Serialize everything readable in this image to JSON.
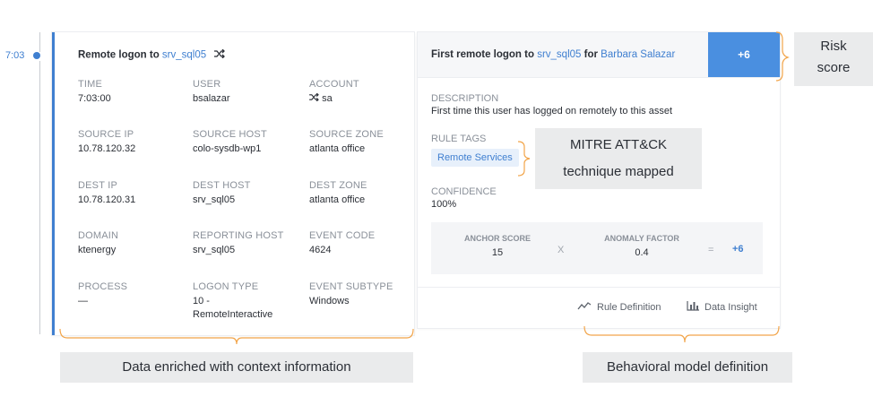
{
  "timeline": {
    "time": "7:03"
  },
  "left_card": {
    "title_prefix": "Remote logon to",
    "title_host": "srv_sql05",
    "fields": {
      "time": {
        "label": "TIME",
        "value": "7:03:00"
      },
      "user": {
        "label": "USER",
        "value": "bsalazar"
      },
      "account": {
        "label": "ACCOUNT",
        "value": "sa"
      },
      "source_ip": {
        "label": "SOURCE IP",
        "value": "10.78.120.32"
      },
      "source_host": {
        "label": "SOURCE HOST",
        "value": "colo-sysdb-wp1"
      },
      "source_zone": {
        "label": "SOURCE ZONE",
        "value": "atlanta office"
      },
      "dest_ip": {
        "label": "DEST IP",
        "value": "10.78.120.31"
      },
      "dest_host": {
        "label": "DEST HOST",
        "value": "srv_sql05"
      },
      "dest_zone": {
        "label": "DEST ZONE",
        "value": "atlanta office"
      },
      "domain": {
        "label": "DOMAIN",
        "value": "ktenergy"
      },
      "reporting_host": {
        "label": "REPORTING HOST",
        "value": "srv_sql05"
      },
      "event_code": {
        "label": "EVENT CODE",
        "value": "4624"
      },
      "process": {
        "label": "PROCESS",
        "value": "—"
      },
      "logon_type": {
        "label": "LOGON TYPE",
        "value_line1": "10 -",
        "value_line2": "RemoteInteractive"
      },
      "event_subtype": {
        "label": "EVENT SUBTYPE",
        "value": "Windows"
      }
    }
  },
  "right_card": {
    "title_prefix": "First remote logon to",
    "title_host": "srv_sql05",
    "title_mid": "for",
    "title_user": "Barbara Salazar",
    "risk_score": "+6",
    "description": {
      "label": "DESCRIPTION",
      "value": "First time this user has logged on remotely to this asset"
    },
    "rule_tags": {
      "label": "RULE TAGS",
      "tag": "Remote Services"
    },
    "confidence": {
      "label": "CONFIDENCE",
      "value": "100%"
    },
    "score": {
      "anchor_label": "ANCHOR SCORE",
      "anchor_value": "15",
      "times": "X",
      "anomaly_label": "ANOMALY FACTOR",
      "anomaly_value": "0.4",
      "equals": "=",
      "result": "+6"
    },
    "footer": {
      "rule_definition": "Rule Definition",
      "data_insight": "Data Insight"
    }
  },
  "annotations": {
    "risk_line1": "Risk",
    "risk_line2": "score",
    "mitre_line1": "MITRE ATT&CK",
    "mitre_line2": "technique mapped",
    "data_enriched": "Data enriched with context information",
    "behavioral": "Behavioral model definition"
  },
  "colors": {
    "accent": "#3f7fd0",
    "score_bg": "#4a8fe0",
    "callout_bg": "#eaebec"
  }
}
